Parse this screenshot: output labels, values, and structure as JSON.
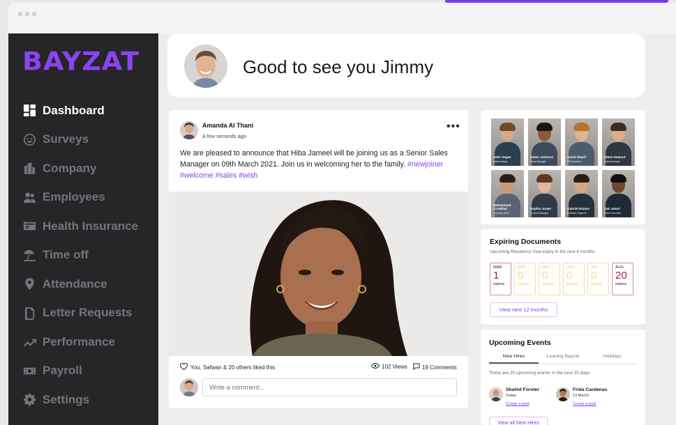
{
  "brand": {
    "logo_text": "BAYZAT",
    "accent": "#7c3aed"
  },
  "sidebar": {
    "items": [
      {
        "label": "Dashboard",
        "icon": "dashboard-icon",
        "active": true
      },
      {
        "label": "Surveys",
        "icon": "smiley-icon"
      },
      {
        "label": "Company",
        "icon": "company-icon"
      },
      {
        "label": "Employees",
        "icon": "employees-icon"
      },
      {
        "label": "Health Insurance",
        "icon": "health-card-icon"
      },
      {
        "label": "Time off",
        "icon": "beach-umbrella-icon"
      },
      {
        "label": "Attendance",
        "icon": "location-pin-icon"
      },
      {
        "label": "Letter Requests",
        "icon": "document-icon"
      },
      {
        "label": "Performance",
        "icon": "trend-icon"
      },
      {
        "label": "Payroll",
        "icon": "cash-icon"
      },
      {
        "label": "Settings",
        "icon": "gear-icon"
      }
    ]
  },
  "greeting": {
    "text": "Good to see you Jimmy"
  },
  "post": {
    "author": "Amanda Al Thani",
    "time": "A few seconds ago",
    "text": "We are pleased to announce that Hiba Jameel will be joining us as a Senior Sales Manager on 09th March 2021. Join us in welcoming her to the family.",
    "tags": "#newjoiner #welcome #sales #wish",
    "likes": "You, Safwan & 20 others liked this",
    "views": "102 Views",
    "comments": "19 Comments",
    "comment_placeholder": "Write a comment..."
  },
  "team": {
    "members": [
      {
        "name": "John Vegas",
        "role": "Sales Analyst"
      },
      {
        "name": "Adam Johnson",
        "role": "Sales Manager"
      },
      {
        "name": "Sarah Sharif",
        "role": "HR Executive"
      },
      {
        "name": "Steve Howard",
        "role": "Sales Manager"
      },
      {
        "name": "Mohammed Crowther",
        "role": "Accounts Clerk"
      },
      {
        "name": "Sophia Jones",
        "role": "Product Manager"
      },
      {
        "name": "Gabriel Edams",
        "role": "Software Engineer"
      },
      {
        "name": "Zak Jabari",
        "role": "Sales Executive"
      }
    ]
  },
  "documents": {
    "title": "Expiring Documents",
    "subtitle": "Upcoming Residency Visa expiry in the next 6 months",
    "months": [
      {
        "name": "MAR",
        "count": "1",
        "label": "expires",
        "highlight": true
      },
      {
        "name": "APR",
        "count": "0",
        "label": "expires",
        "highlight": false
      },
      {
        "name": "MAY",
        "count": "0",
        "label": "expires",
        "highlight": false
      },
      {
        "name": "JUN",
        "count": "0",
        "label": "expires",
        "highlight": false
      },
      {
        "name": "JUL",
        "count": "0",
        "label": "expires",
        "highlight": false
      },
      {
        "name": "AUG",
        "count": "20",
        "label": "expires",
        "highlight": true
      }
    ],
    "button": "View next 12 months"
  },
  "events": {
    "title": "Upcoming Events",
    "tabs": [
      "New Hires",
      "Leaving Bayzat",
      "Holidays"
    ],
    "subtitle": "There are 20 upcoming events in the next 30 days",
    "items": [
      {
        "name": "Shahid Forster",
        "date": "Today",
        "link": "Create a post"
      },
      {
        "name": "Frida Cardenas",
        "date": "13 March",
        "link": "Create a post"
      }
    ],
    "button": "View all New Hires"
  }
}
